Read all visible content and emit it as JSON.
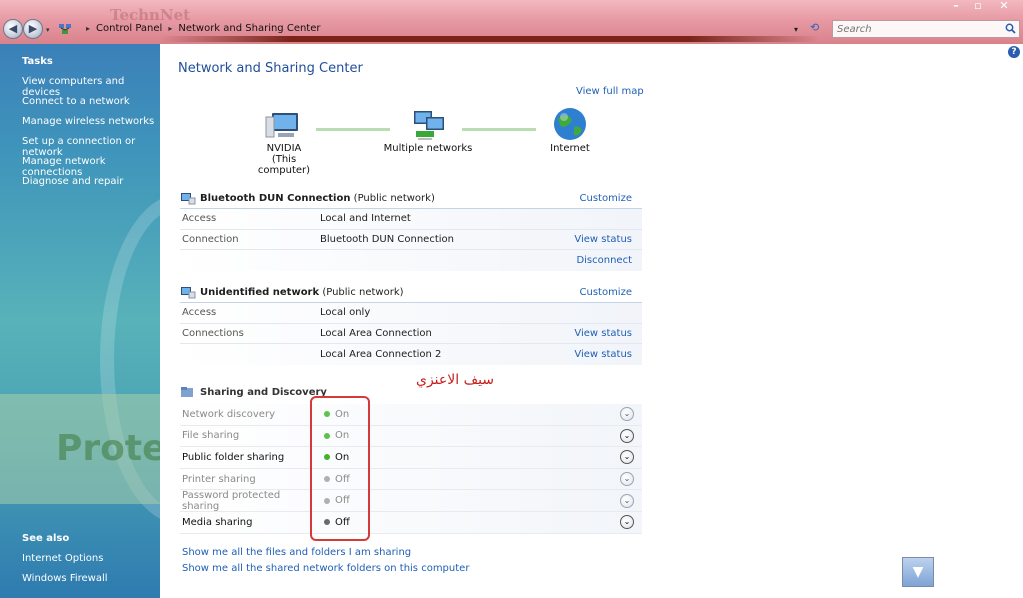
{
  "address": {
    "crumbs": [
      "Control Panel",
      "Network and Sharing Center"
    ],
    "search_placeholder": "Search"
  },
  "tasks": {
    "heading": "Tasks",
    "items": [
      "View computers and devices",
      "Connect to a network",
      "Manage wireless networks",
      "Set up a connection or network",
      "Manage network connections",
      "Diagnose and repair"
    ]
  },
  "see_also": {
    "heading": "See also",
    "items": [
      "Internet Options",
      "Windows Firewall"
    ]
  },
  "main": {
    "title": "Network and Sharing Center",
    "view_full_map": "View full map",
    "map": {
      "computer_name": "NVIDIA",
      "computer_sub": "(This computer)",
      "networks": "Multiple networks",
      "internet": "Internet"
    },
    "networks": [
      {
        "name": "Bluetooth DUN Connection",
        "type": "(Public network)",
        "customize": "Customize",
        "rows": [
          {
            "key": "Access",
            "value": "Local and Internet",
            "link": ""
          },
          {
            "key": "Connection",
            "value": "Bluetooth DUN Connection",
            "link": "View status"
          },
          {
            "key": "",
            "value": "",
            "link": "Disconnect"
          }
        ]
      },
      {
        "name": "Unidentified network",
        "type": "(Public network)",
        "customize": "Customize",
        "rows": [
          {
            "key": "Access",
            "value": "Local only",
            "link": ""
          },
          {
            "key": "Connections",
            "value": "Local Area Connection",
            "link": "View status"
          },
          {
            "key": "",
            "value": "Local Area Connection 2",
            "link": "View status"
          }
        ]
      }
    ],
    "annotation": "سيف الاعنزي",
    "sharing": {
      "heading": "Sharing and Discovery",
      "rows": [
        {
          "label": "Network discovery",
          "state": "On",
          "dot": "#5cc24a"
        },
        {
          "label": "File sharing",
          "state": "On",
          "dot": "#5cc24a"
        },
        {
          "label": "Public folder sharing",
          "state": "On",
          "dot": "#3fb52f"
        },
        {
          "label": "Printer sharing",
          "state": "Off",
          "dot": "#b0b0b0"
        },
        {
          "label": "Password protected sharing",
          "state": "Off",
          "dot": "#b0b0b0"
        },
        {
          "label": "Media sharing",
          "state": "Off",
          "dot": "#6a6a6a"
        }
      ]
    },
    "bottom_links": [
      "Show me all the files and folders I am sharing",
      "Show me all the shared network folders on this computer"
    ]
  }
}
